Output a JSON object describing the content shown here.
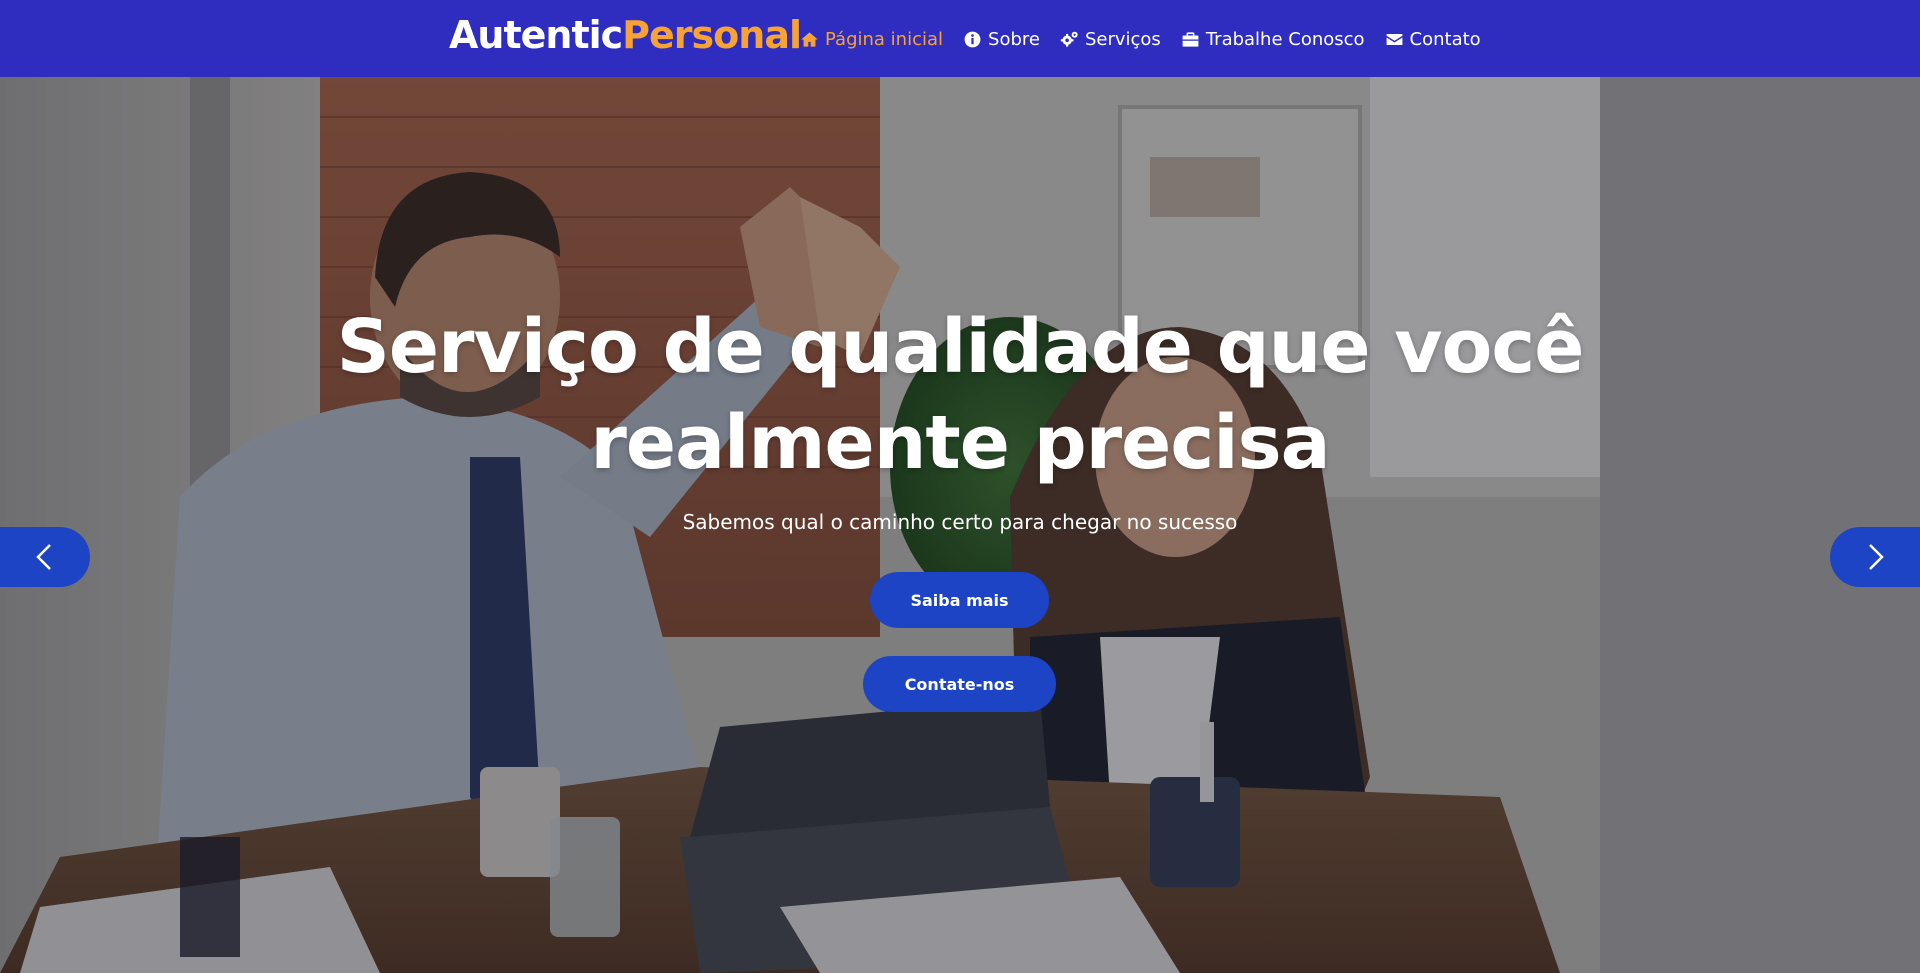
{
  "brand": {
    "part1": "Autentic",
    "part2": "Personal"
  },
  "nav": {
    "items": [
      {
        "label": "Página inicial",
        "icon": "home-icon",
        "active": true
      },
      {
        "label": "Sobre",
        "icon": "info-icon",
        "active": false
      },
      {
        "label": "Serviços",
        "icon": "gears-icon",
        "active": false
      },
      {
        "label": "Trabalhe Conosco",
        "icon": "briefcase-icon",
        "active": false
      },
      {
        "label": "Contato",
        "icon": "envelope-icon",
        "active": false
      }
    ]
  },
  "hero": {
    "title": "Serviço de qualidade que você realmente precisa",
    "subtitle": "Sabemos qual o caminho certo para chegar no sucesso",
    "primary_button": "Saiba mais",
    "secondary_button": "Contate-nos"
  },
  "colors": {
    "navbar": "#2e2dbf",
    "accent": "#f7a234",
    "button": "#1c44c4"
  }
}
